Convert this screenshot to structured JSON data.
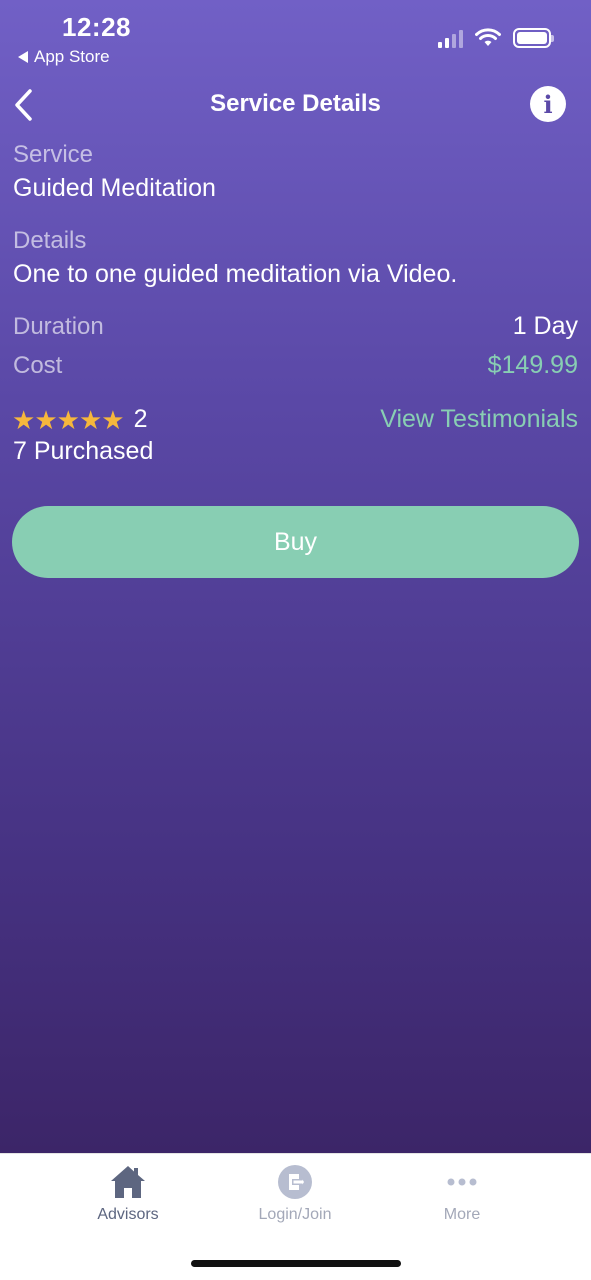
{
  "status_bar": {
    "time": "12:28",
    "back_app": "App Store"
  },
  "nav": {
    "title": "Service Details",
    "back_icon": "chevron-left-icon",
    "info_icon": "info-icon"
  },
  "service": {
    "label": "Service",
    "value": "Guided Meditation"
  },
  "details": {
    "label": "Details",
    "value": "One to one guided meditation via Video."
  },
  "duration": {
    "label": "Duration",
    "value": "1 Day"
  },
  "cost": {
    "label": "Cost",
    "value": "$149.99"
  },
  "rating": {
    "stars": 5,
    "count": "2"
  },
  "testimonials_link": "View Testimonials",
  "purchased": "7 Purchased",
  "buy_button": "Buy",
  "tabs": [
    {
      "label": "Advisors",
      "icon": "home-icon",
      "active": true
    },
    {
      "label": "Login/Join",
      "icon": "login-icon",
      "active": false
    },
    {
      "label": "More",
      "icon": "more-icon",
      "active": false
    }
  ],
  "colors": {
    "accent_green": "#88ceb3",
    "star": "#f6b73c",
    "bg_top": "#7160c6",
    "bg_bottom": "#3c2568"
  }
}
